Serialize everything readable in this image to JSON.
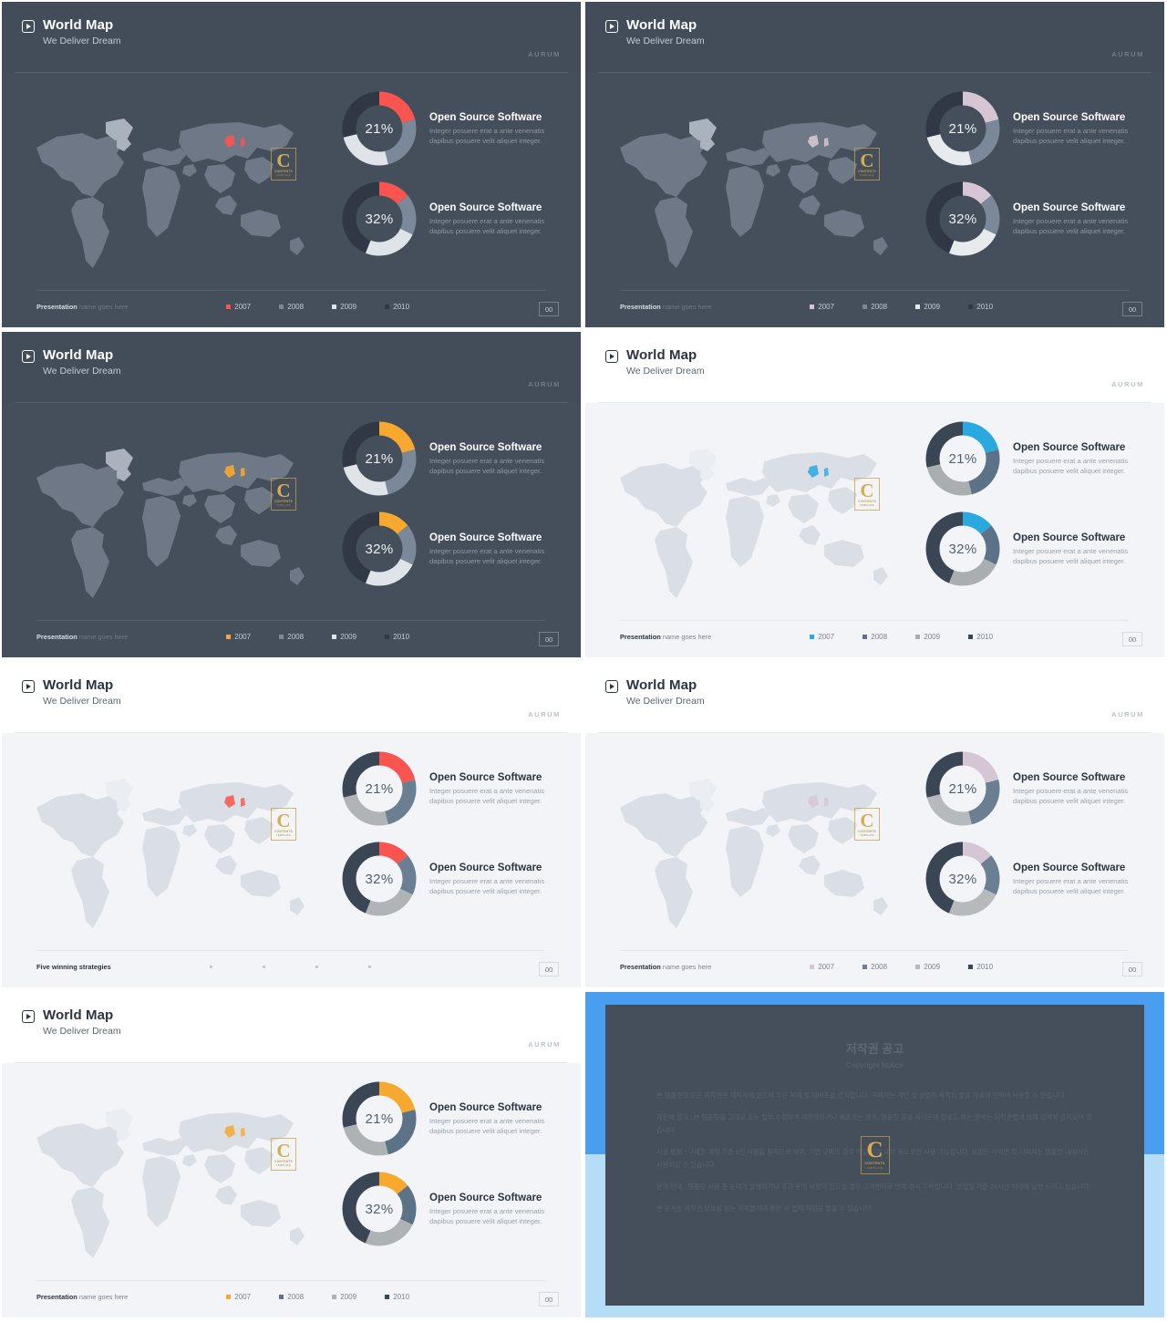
{
  "brand": "AURUM",
  "header": {
    "title": "World Map",
    "subtitle": "We Deliver Dream",
    "play_icon": "play-icon"
  },
  "stats": [
    {
      "percent": "21%",
      "title": "Open Source Software",
      "desc": "Integer posuere erat a ante venenatis dapibus posuere velit aliquet integer."
    },
    {
      "percent": "32%",
      "title": "Open Source Software",
      "desc": "Integer posuere erat a ante venenatis dapibus posuere velit aliquet integer."
    }
  ],
  "footer": {
    "name_strong": "Presentation",
    "name_light": " name goes here",
    "alt_name_strong": "Five winning strategies",
    "alt_name_light": "",
    "page": "00",
    "legend": [
      "2007",
      "2008",
      "2009",
      "2010"
    ]
  },
  "copyright": {
    "heading_ko": "저작권 공고",
    "heading_en": "Copyright Notice",
    "paragraphs": [
      "본 템플릿의 모든 저작권은 제작사에 있으며 무단 복제 및 재배포를 금지합니다. 구매자는 개인 및 상업적 목적의 발표 자료에 한하여 사용할 수 있습니다.",
      "재판매 금지 : 본 템플릿을 그대로 또는 일부 수정하여 재판매하거나 배포하는 행위, 템플릿 공유 사이트에 업로드 하는 행위는 저작권법에 의해 엄격히 금지되어 있습니다.",
      "사용 범위 : 구매한 계정 기준 1인 사용을 원칙으로 하며, 기업 구매의 경우 해당 기업 내부 용도로만 사용 가능합니다. 포함된 아이콘 및 이미지는 템플릿 내에서만 사용하실 수 있습니다.",
      "문의 안내 : 템플릿 사용 중 문제가 발생하거나 추가 문의 사항이 있으실 경우 고객센터로 연락 주시기 바랍니다. 영업일 기준 24시간 이내에 답변 드리고 있습니다.",
      "본 문서는 저작권 보호를 받는 저작물이며 위반 시 법적 책임을 물을 수 있습니다."
    ],
    "logo_letter": "C",
    "logo_line2": "CONTENTS",
    "logo_line3": "TEMPLATE"
  },
  "logo": {
    "letter": "C",
    "line2": "CONTENTS",
    "line3": "TEMPLATE"
  },
  "colors": {
    "dark_bg": "#454f5c",
    "light_bg": "#f2f4f7",
    "accent_red": "#f9544f",
    "accent_pink": "#d3c3d0",
    "accent_orange": "#f7a82e",
    "accent_cyan": "#2aa9e0",
    "blue_top": "#4a9ef0",
    "blue_bottom": "#b5ddf8"
  },
  "chart_data": [
    {
      "type": "pie",
      "title": "Open Source Software 21%",
      "center_label": "21%",
      "categories": [
        "2007",
        "2008",
        "2009",
        "2010"
      ],
      "values": [
        21,
        25,
        25,
        29
      ]
    },
    {
      "type": "pie",
      "title": "Open Source Software 32%",
      "center_label": "32%",
      "categories": [
        "2007",
        "2008",
        "2009",
        "2010"
      ],
      "values": [
        14,
        18,
        24,
        44
      ]
    }
  ],
  "slides": [
    {
      "theme": "dark",
      "accent": "#f9544f",
      "s2": "#7a8899",
      "s3": "#dfe4e8",
      "s4": "#2f3844",
      "footer_variant": "default"
    },
    {
      "theme": "dark",
      "accent": "#d6c6d3",
      "s2": "#7a8899",
      "s3": "#e7ebee",
      "s4": "#2f3844",
      "footer_variant": "default"
    },
    {
      "theme": "dark",
      "accent": "#f7a82e",
      "s2": "#7a8899",
      "s3": "#dfe4e8",
      "s4": "#2f3844",
      "footer_variant": "default"
    },
    {
      "theme": "light",
      "accent": "#2aa9e0",
      "s2": "#5c7286",
      "s3": "#a9aeb0",
      "s4": "#3a4654",
      "footer_variant": "default"
    },
    {
      "theme": "light",
      "accent": "#f9544f",
      "s2": "#6b7f93",
      "s3": "#b0b4b6",
      "s4": "#3a4654",
      "footer_variant": "alt"
    },
    {
      "theme": "light",
      "accent": "#d6c6d3",
      "s2": "#6b7f93",
      "s3": "#b6babc",
      "s4": "#3a4654",
      "footer_variant": "default"
    },
    {
      "theme": "light",
      "accent": "#f7a82e",
      "s2": "#5c7286",
      "s3": "#aeb2b4",
      "s4": "#3a4654",
      "footer_variant": "default"
    }
  ]
}
